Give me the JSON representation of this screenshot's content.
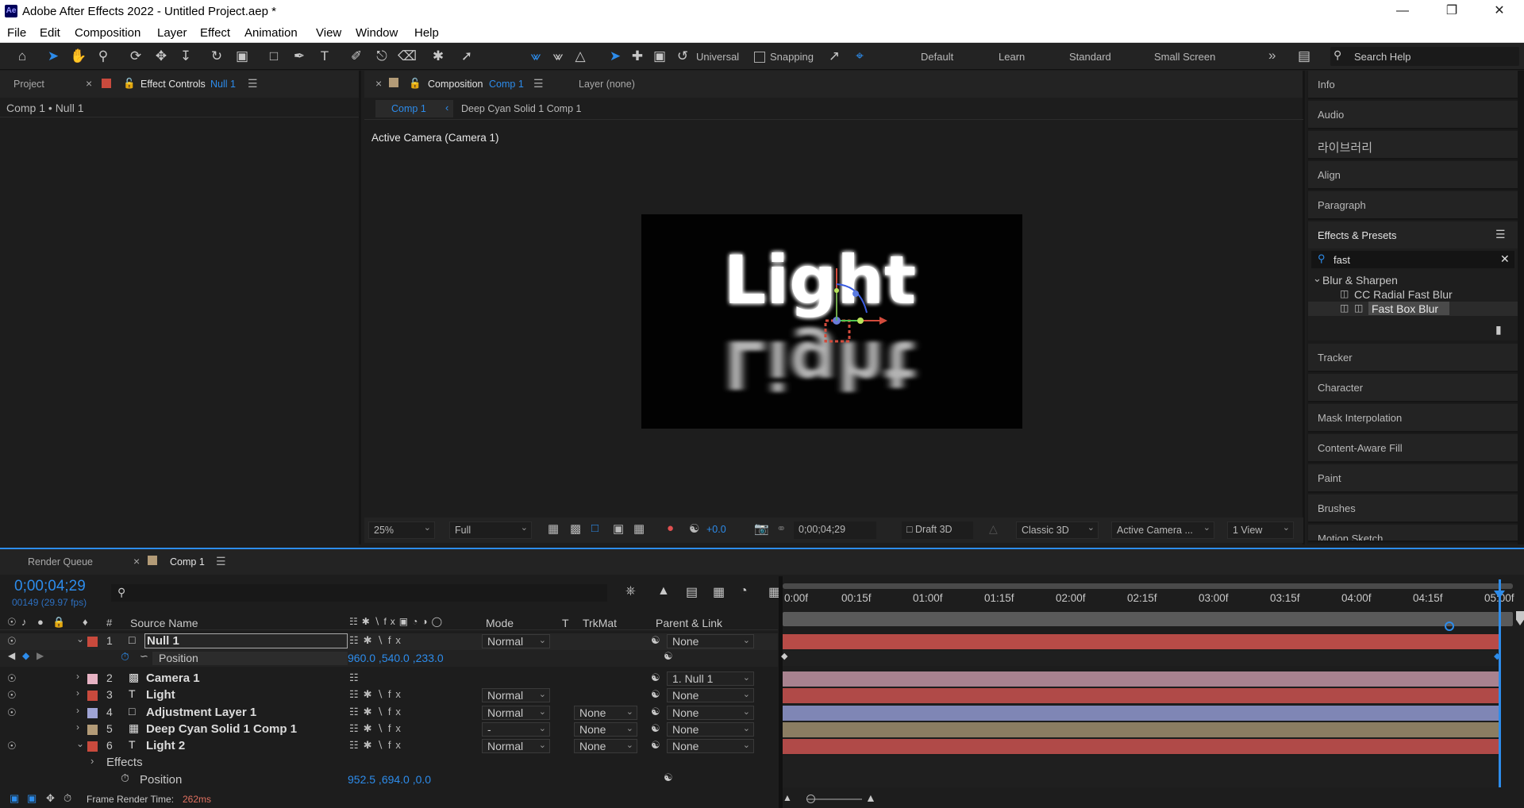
{
  "window": {
    "title": "Adobe After Effects 2022 - Untitled Project.aep *",
    "app_badge": "Ae",
    "controls": [
      "minimize",
      "restore",
      "close"
    ]
  },
  "menu": [
    "File",
    "Edit",
    "Composition",
    "Layer",
    "Effect",
    "Animation",
    "View",
    "Window",
    "Help"
  ],
  "toolbar": {
    "axis_mode": "Universal",
    "snapping_label": "Snapping",
    "workspaces": [
      "Default",
      "Learn",
      "Standard",
      "Small Screen"
    ],
    "more": "»",
    "search_placeholder": "Search Help"
  },
  "project_panel": {
    "tab_project": "Project",
    "tab_effect_controls": "Effect Controls",
    "effect_controls_target": "Null 1",
    "breadcrumb": "Comp 1 • Null 1"
  },
  "comp_panel": {
    "tab_label": "Composition",
    "tab_comp": "Comp 1",
    "layer_tab": "Layer (none)",
    "flow_current": "Comp 1",
    "flow_next": "Deep Cyan Solid 1 Comp 1",
    "camera_label": "Active Camera (Camera 1)",
    "canvas_text": "Light",
    "zoom": "25%",
    "resolution": "Full",
    "exposure": "+0.0",
    "timecode": "0;00;04;29",
    "draft": "Draft 3D",
    "renderer": "Classic 3D",
    "camera": "Active Camera ...",
    "views": "1 View"
  },
  "right_panel": {
    "items_top": [
      "Info",
      "Audio",
      "라이브러리",
      "Align",
      "Paragraph"
    ],
    "effects_presets_title": "Effects & Presets",
    "search_value": "fast",
    "category": "Blur & Sharpen",
    "effects": [
      "CC Radial Fast Blur",
      "Fast Box Blur"
    ],
    "items_bottom": [
      "Tracker",
      "Character",
      "Mask Interpolation",
      "Content-Aware Fill",
      "Paint",
      "Brushes",
      "Motion Sketch"
    ]
  },
  "timeline": {
    "tab_render_queue": "Render Queue",
    "tab_comp": "Comp 1",
    "timecode": "0;00;04;29",
    "frame_info": "00149 (29.97 fps)",
    "columns": {
      "num": "#",
      "source_name": "Source Name",
      "mode": "Mode",
      "t": "T",
      "trkmat": "TrkMat",
      "parent": "Parent & Link"
    },
    "ruler": [
      "0:00f",
      "00:15f",
      "01:00f",
      "01:15f",
      "02:00f",
      "02:15f",
      "03:00f",
      "03:15f",
      "04:00f",
      "04:15f",
      "05:00f"
    ],
    "layers": [
      {
        "num": "1",
        "name": "Null 1",
        "type": "null",
        "color": "#c94a3d",
        "mode": "Normal",
        "trkmat": "",
        "parent": "None",
        "bar_color": "#b84b47"
      },
      {
        "num": "2",
        "name": "Camera 1",
        "type": "camera",
        "color": "#e7b3c4",
        "mode": "",
        "trkmat": "",
        "parent": "1. Null 1",
        "bar_color": "#a8828f"
      },
      {
        "num": "3",
        "name": "Light",
        "type": "text",
        "color": "#c94a3d",
        "mode": "Normal",
        "trkmat": "",
        "parent": "None",
        "bar_color": "#b04a48"
      },
      {
        "num": "4",
        "name": "Adjustment Layer 1",
        "type": "adjustment",
        "color": "#9fa4d4",
        "mode": "Normal",
        "trkmat": "None",
        "parent": "None",
        "bar_color": "#7f86b5"
      },
      {
        "num": "5",
        "name": "Deep Cyan Solid 1 Comp 1",
        "type": "precomp",
        "color": "#b39b77",
        "mode": "-",
        "trkmat": "None",
        "parent": "None",
        "bar_color": "#8b7d62"
      },
      {
        "num": "6",
        "name": "Light 2",
        "type": "text",
        "color": "#c94a3d",
        "mode": "Normal",
        "trkmat": "None",
        "parent": "None",
        "bar_color": "#b04a48"
      }
    ],
    "null_position_label": "Position",
    "null_position_value": "960.0 ,540.0 ,233.0",
    "effects_label": "Effects",
    "light2_position_label": "Position",
    "light2_position_value": "952.5 ,694.0 ,0.0",
    "status": "Frame Render Time:",
    "render_time": "262ms"
  }
}
